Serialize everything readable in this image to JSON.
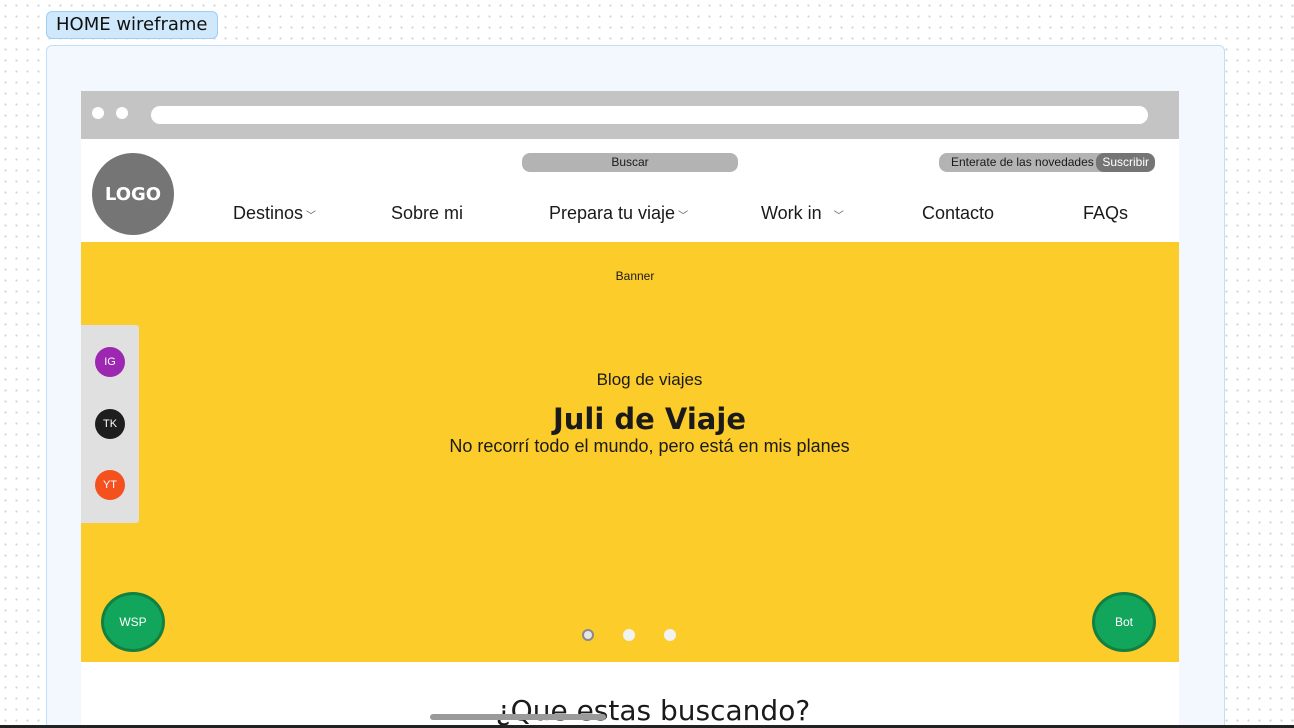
{
  "frame": {
    "label": "HOME wireframe"
  },
  "header": {
    "logo": "LOGO",
    "search_label": "Buscar",
    "newsletter_text": "Enterate de las novedades",
    "subscribe_label": "Suscribir",
    "nav": [
      {
        "label": "Destinos",
        "has_dropdown": true
      },
      {
        "label": "Sobre mi",
        "has_dropdown": false
      },
      {
        "label": "Prepara tu viaje",
        "has_dropdown": true
      },
      {
        "label": "Work in",
        "has_dropdown": true
      },
      {
        "label": "Contacto",
        "has_dropdown": false
      },
      {
        "label": "FAQs",
        "has_dropdown": false
      }
    ]
  },
  "banner": {
    "label": "Banner",
    "kicker": "Blog de viajes",
    "title": "Juli de Viaje",
    "subtitle": "No recorrí todo el mundo, pero está en mis planes",
    "carousel": {
      "total": 3,
      "active": 1
    }
  },
  "social": [
    {
      "label": "IG",
      "color": "#9c27b0"
    },
    {
      "label": "TK",
      "color": "#1e1e1e"
    },
    {
      "label": "YT",
      "color": "#f4511e"
    }
  ],
  "floating": {
    "whatsapp_label": "WSP",
    "bot_label": "Bot"
  },
  "sections": {
    "search_title": "¿Que estas buscando?"
  },
  "colors": {
    "banner": "#fccc2a",
    "frame": "#f2f8fd",
    "frame_border": "#bfe0f6",
    "float_button": "#12a55c"
  }
}
